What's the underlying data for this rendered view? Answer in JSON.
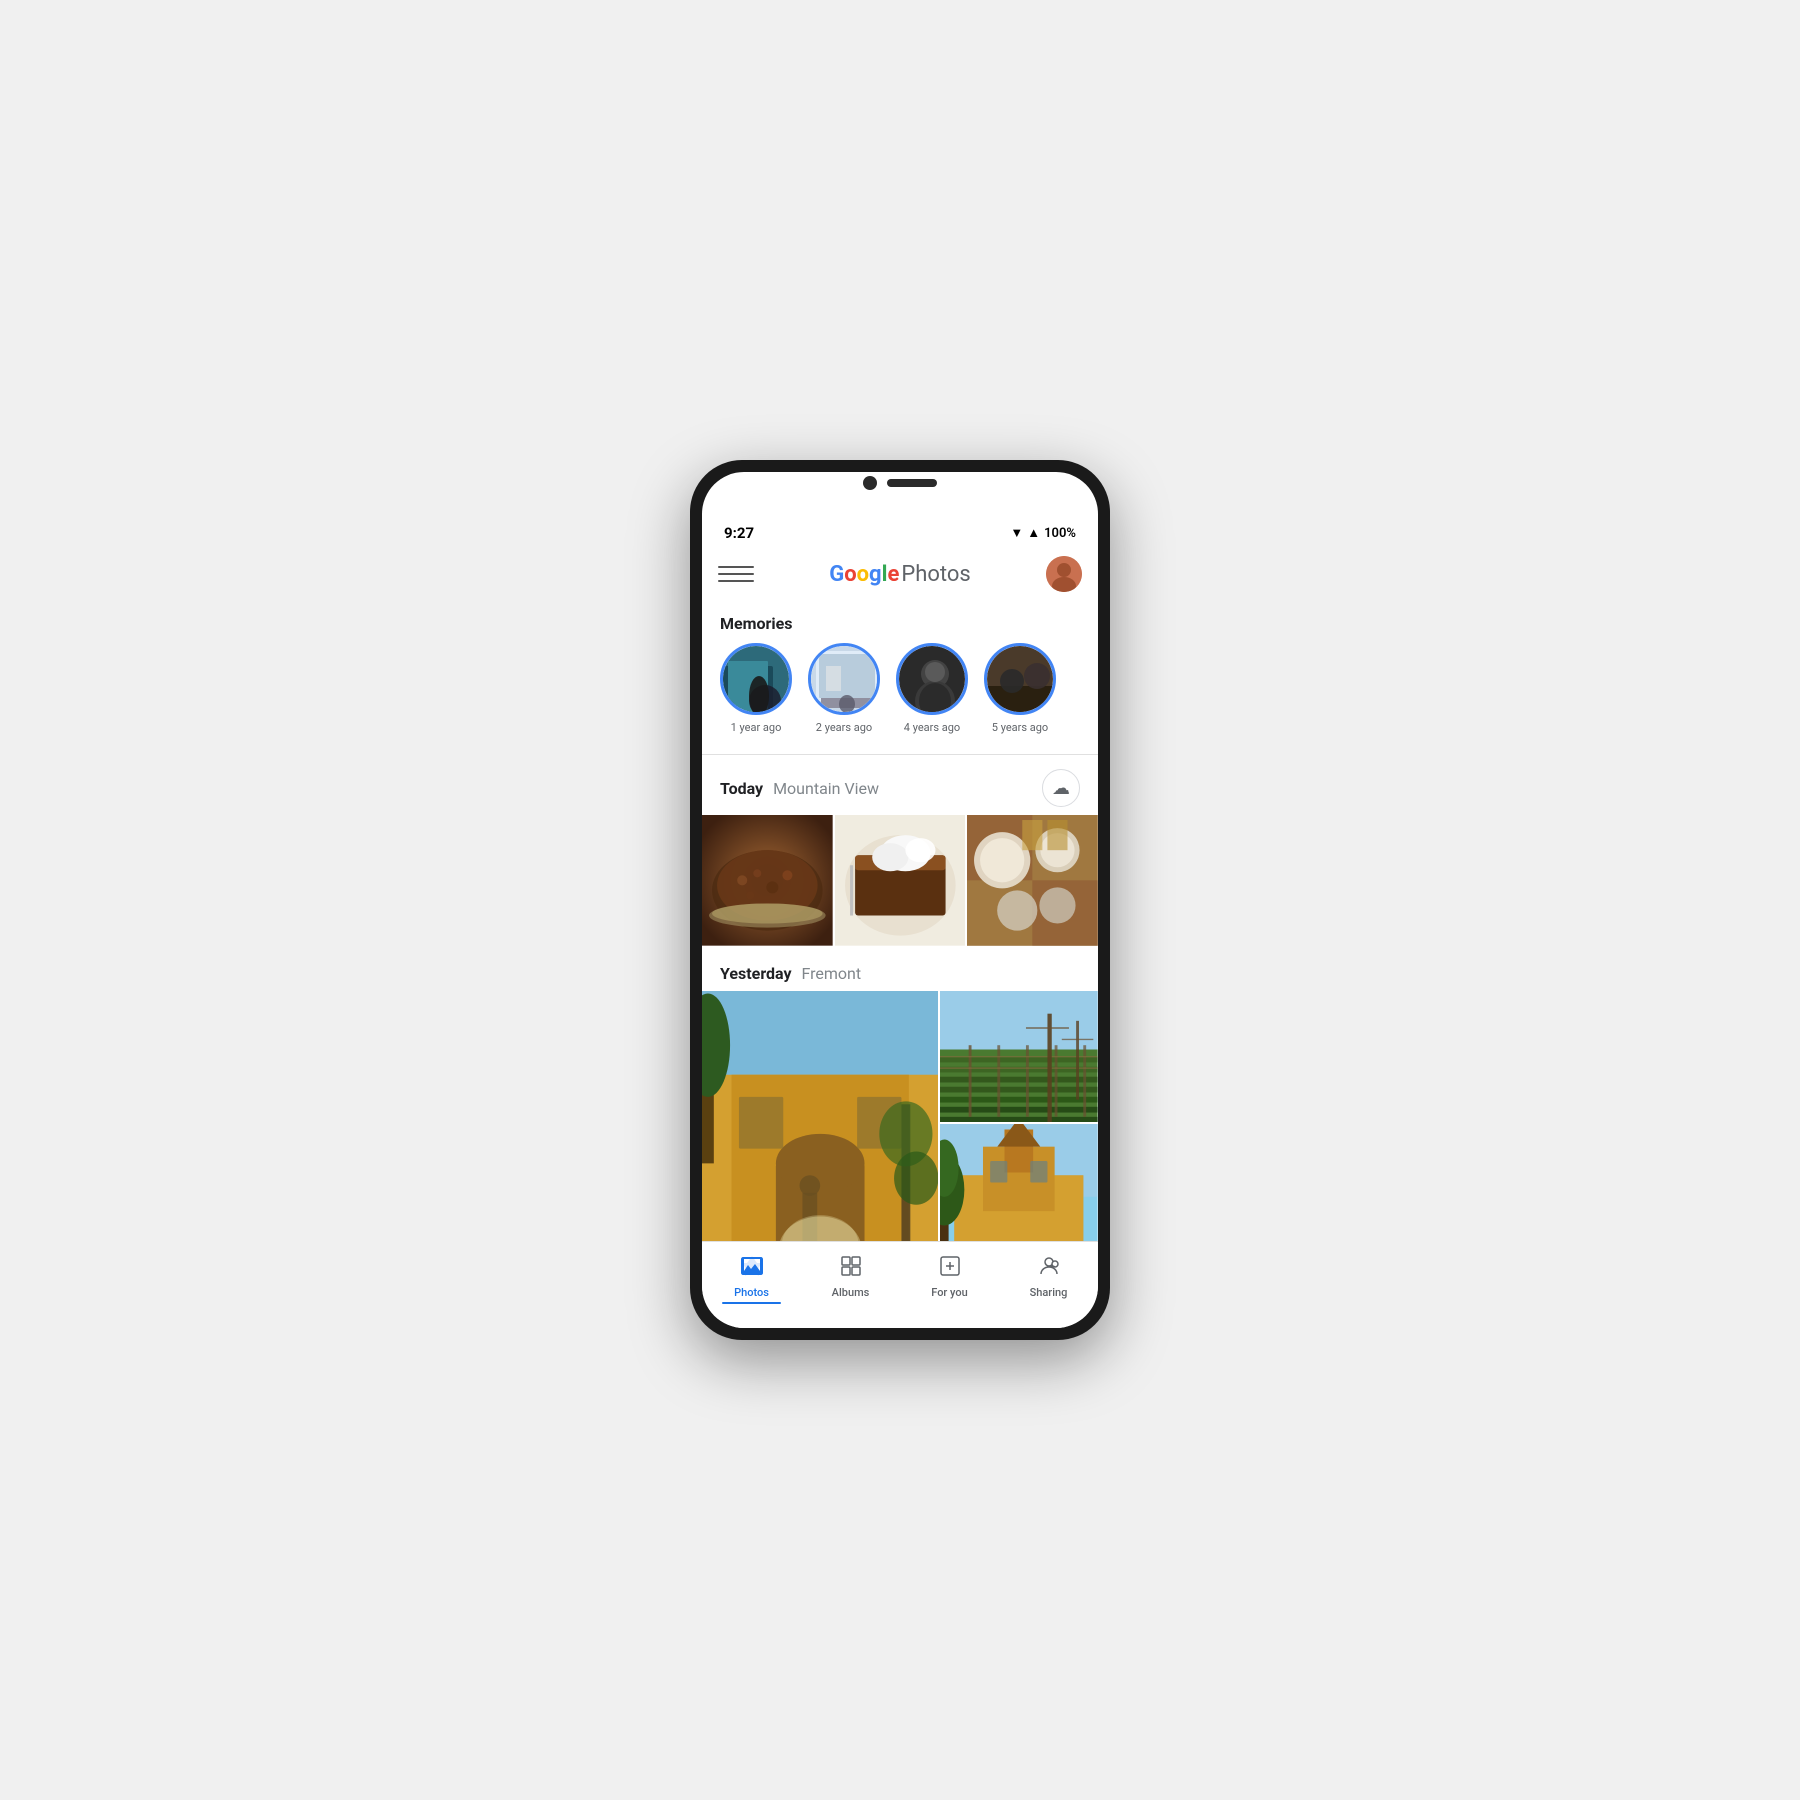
{
  "phone": {
    "status": {
      "time": "9:27",
      "battery": "100%"
    }
  },
  "header": {
    "menu_label": "☰",
    "logo_text": "Google Photos",
    "logo_parts": {
      "G": "G",
      "o1": "o",
      "o2": "o",
      "g": "g",
      "l": "l",
      "e": "e",
      "photos": " Photos"
    }
  },
  "memories": {
    "section_title": "Memories",
    "items": [
      {
        "label": "1 year ago",
        "color": "#3a8fa0"
      },
      {
        "label": "2 years ago",
        "color": "#607d8b"
      },
      {
        "label": "4 years ago",
        "color": "#37474f"
      },
      {
        "label": "5 years ago",
        "color": "#5d4037"
      }
    ]
  },
  "today_section": {
    "date_label": "Today",
    "location": "Mountain View",
    "cloud_icon": "☁"
  },
  "yesterday_section": {
    "date_label": "Yesterday",
    "location": "Fremont"
  },
  "bottom_nav": {
    "items": [
      {
        "id": "photos",
        "label": "Photos",
        "icon": "🏔",
        "active": true
      },
      {
        "id": "albums",
        "label": "Albums",
        "icon": "▣",
        "active": false
      },
      {
        "id": "for-you",
        "label": "For you",
        "icon": "⊞",
        "active": false
      },
      {
        "id": "sharing",
        "label": "Sharing",
        "icon": "👤",
        "active": false
      }
    ]
  }
}
